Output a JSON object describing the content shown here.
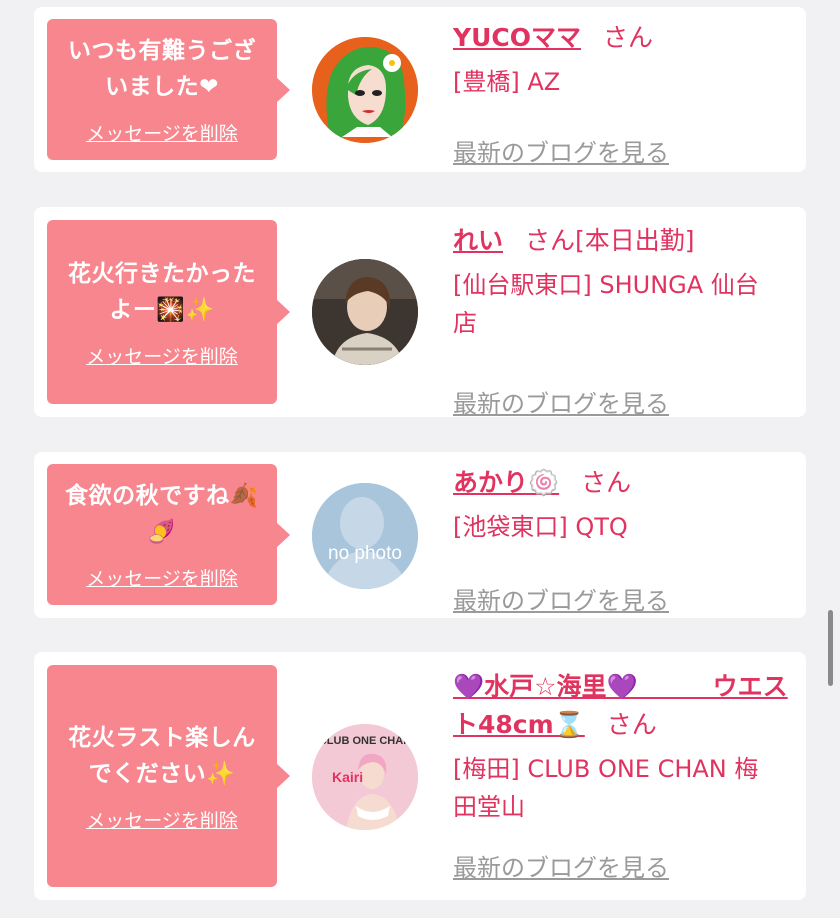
{
  "cards": [
    {
      "message": "いつも有難うござ\nいました❤",
      "delete_label": "メッセージを削除",
      "name": "YUCOママ",
      "san": "さん",
      "status": "",
      "shop": "[豊橋] AZ",
      "blog_label": "最新のブログを見る",
      "avatar_icon": "green-hair-illustration"
    },
    {
      "message": "花火行きたかった\nよー🎇✨",
      "delete_label": "メッセージを削除",
      "name": "れい",
      "san": "さん",
      "status": "[本日出勤]",
      "shop": "[仙台駅東口] SHUNGA 仙台店",
      "blog_label": "最新のブログを見る",
      "avatar_icon": "profile-photo"
    },
    {
      "message": "食欲の秋ですね🍂\n🍠",
      "delete_label": "メッセージを削除",
      "name": "あかり🍥",
      "san": "さん",
      "status": "",
      "shop": "[池袋東口] QTQ",
      "blog_label": "最新のブログを見る",
      "avatar_icon": "no-photo",
      "avatar_text": "no photo"
    },
    {
      "message": "花火ラスト楽しん\nでください✨",
      "delete_label": "メッセージを削除",
      "name": "💜水戸☆海里💜　　　ウエスト48cm⌛",
      "san": "さん",
      "status": "",
      "shop": "[梅田] CLUB ONE CHAN 梅田堂山",
      "blog_label": "最新のブログを見る",
      "avatar_icon": "club-photo",
      "avatar_text": "CLUB ONE CHAN",
      "avatar_sub": "Kairi"
    }
  ]
}
